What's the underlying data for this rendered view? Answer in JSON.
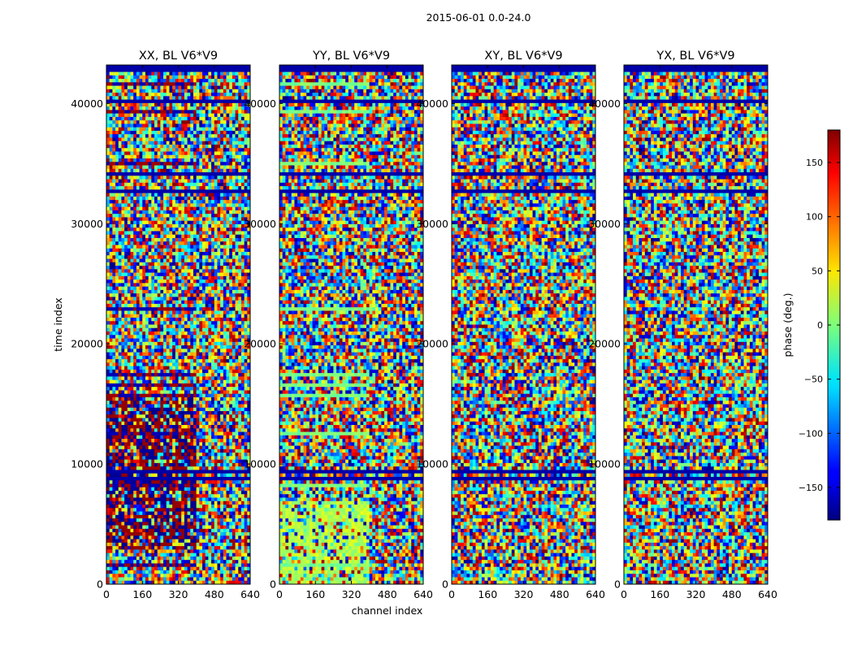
{
  "figure": {
    "suptitle": "2015-06-01 0.0-24.0"
  },
  "colorbar": {
    "label": "phase (deg.)",
    "colormap": "jet",
    "range": [
      -180,
      180
    ],
    "ticks": [
      "150",
      "100",
      "50",
      "0",
      "−50",
      "−100",
      "−150"
    ],
    "tick_values": [
      150,
      100,
      50,
      0,
      -50,
      -100,
      -150
    ]
  },
  "chart_data": [
    {
      "type": "heatmap",
      "title": "XX, BL V6*V9",
      "xlabel": "",
      "ylabel": "time index",
      "x_ticks": [
        "0",
        "160",
        "320",
        "480",
        "640"
      ],
      "x_tick_values": [
        0,
        160,
        320,
        480,
        640
      ],
      "y_ticks": [
        "0",
        "10000",
        "20000",
        "30000",
        "40000"
      ],
      "y_tick_values": [
        0,
        10000,
        20000,
        30000,
        40000
      ],
      "xlim": [
        0,
        640
      ],
      "ylim": [
        0,
        43200
      ],
      "value_label": "phase (deg.)",
      "value_range": [
        -180,
        180
      ],
      "description_values": "noisy phase, low-channel half saturated near ±180 deg at many time rows"
    },
    {
      "type": "heatmap",
      "title": "YY, BL V6*V9",
      "xlabel": "channel index",
      "ylabel": "",
      "x_ticks": [
        "0",
        "160",
        "320",
        "480",
        "640"
      ],
      "x_tick_values": [
        0,
        160,
        320,
        480,
        640
      ],
      "y_ticks": [
        "0",
        "10000",
        "20000",
        "30000",
        "40000"
      ],
      "y_tick_values": [
        0,
        10000,
        20000,
        30000,
        40000
      ],
      "xlim": [
        0,
        640
      ],
      "ylim": [
        0,
        43200
      ],
      "value_label": "phase (deg.)",
      "value_range": [
        -180,
        180
      ]
    },
    {
      "type": "heatmap",
      "title": "XY, BL V6*V9",
      "xlabel": "",
      "ylabel": "",
      "x_ticks": [
        "0",
        "160",
        "320",
        "480",
        "640"
      ],
      "x_tick_values": [
        0,
        160,
        320,
        480,
        640
      ],
      "y_ticks": [
        "0",
        "10000",
        "20000",
        "30000",
        "40000"
      ],
      "y_tick_values": [
        0,
        10000,
        20000,
        30000,
        40000
      ],
      "xlim": [
        0,
        640
      ],
      "ylim": [
        0,
        43200
      ],
      "value_label": "phase (deg.)",
      "value_range": [
        -180,
        180
      ]
    },
    {
      "type": "heatmap",
      "title": "YX, BL V6*V9",
      "xlabel": "",
      "ylabel": "",
      "x_ticks": [
        "0",
        "160",
        "320",
        "480",
        "640"
      ],
      "x_tick_values": [
        0,
        160,
        320,
        480,
        640
      ],
      "y_ticks": [
        "0",
        "10000",
        "20000",
        "30000",
        "40000"
      ],
      "y_tick_values": [
        0,
        10000,
        20000,
        30000,
        40000
      ],
      "xlim": [
        0,
        640
      ],
      "ylim": [
        0,
        43200
      ],
      "value_label": "phase (deg.)",
      "value_range": [
        -180,
        180
      ]
    }
  ]
}
